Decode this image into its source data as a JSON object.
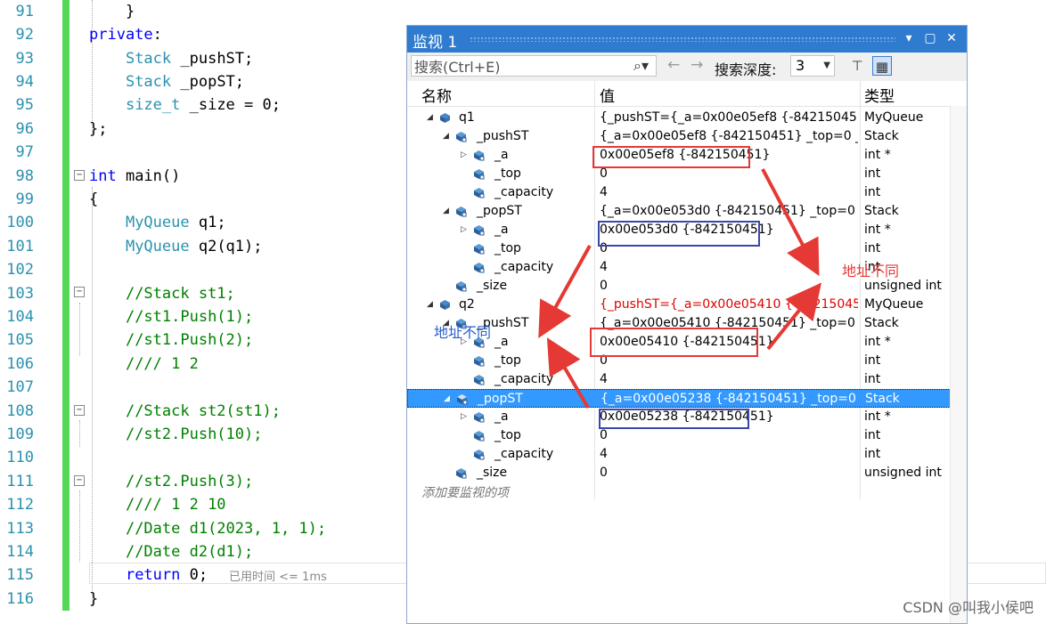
{
  "editor": {
    "line_numbers": [
      "91",
      "92",
      "93",
      "94",
      "95",
      "96",
      "97",
      "98",
      "99",
      "100",
      "101",
      "102",
      "103",
      "104",
      "105",
      "106",
      "107",
      "108",
      "109",
      "110",
      "111",
      "112",
      "113",
      "114",
      "115",
      "116"
    ],
    "elapsed_hint": "已用时间 <= 1ms"
  },
  "watch": {
    "title": "监视 1",
    "search_placeholder": "搜索(Ctrl+E)",
    "depth_label": "搜索深度:",
    "depth_value": "3",
    "columns": {
      "name": "名称",
      "value": "值",
      "type": "类型"
    },
    "rows": [
      {
        "name": "q1",
        "value": "{_pushST={_a=0x00e05ef8 {-842150451} _t...",
        "type": "MyQueue"
      },
      {
        "name": "_pushST",
        "value": "{_a=0x00e05ef8 {-842150451} _top=0 _cap...",
        "type": "Stack"
      },
      {
        "name": "_a",
        "value": "0x00e05ef8 {-842150451}",
        "type": "int *"
      },
      {
        "name": "_top",
        "value": "0",
        "type": "int"
      },
      {
        "name": "_capacity",
        "value": "4",
        "type": "int"
      },
      {
        "name": "_popST",
        "value": "{_a=0x00e053d0 {-842150451} _top=0 _ca...",
        "type": "Stack"
      },
      {
        "name": "_a",
        "value": "0x00e053d0 {-842150451}",
        "type": "int *"
      },
      {
        "name": "_top",
        "value": "0",
        "type": "int"
      },
      {
        "name": "_capacity",
        "value": "4",
        "type": "int"
      },
      {
        "name": "_size",
        "value": "0",
        "type": "unsigned int"
      },
      {
        "name": "q2",
        "value": "{_pushST={_a=0x00e05410 {-842150451} _t...",
        "type": "MyQueue"
      },
      {
        "name": "_pushST",
        "value": "{_a=0x00e05410 {-842150451} _top=0 _ca...",
        "type": "Stack"
      },
      {
        "name": "_a",
        "value": "0x00e05410 {-842150451}",
        "type": "int *"
      },
      {
        "name": "_top",
        "value": "0",
        "type": "int"
      },
      {
        "name": "_capacity",
        "value": "4",
        "type": "int"
      },
      {
        "name": "_popST",
        "value": "{_a=0x00e05238 {-842150451} _top=0 _ca...",
        "type": "Stack"
      },
      {
        "name": "_a",
        "value": "0x00e05238 {-842150451}",
        "type": "int *"
      },
      {
        "name": "_top",
        "value": "0",
        "type": "int"
      },
      {
        "name": "_capacity",
        "value": "4",
        "type": "int"
      },
      {
        "name": "_size",
        "value": "0",
        "type": "unsigned int"
      }
    ],
    "add_hint": "添加要监视的项"
  },
  "annotations": {
    "right_note": "地址不同",
    "left_note": "地址不同",
    "watermark": "CSDN @叫我小侯吧"
  },
  "colors": {
    "accent": "#2e7bd0",
    "selection": "#3399ff",
    "red_box": "#e53935",
    "blue_box": "#3949ab",
    "change_bar": "#57d657"
  }
}
